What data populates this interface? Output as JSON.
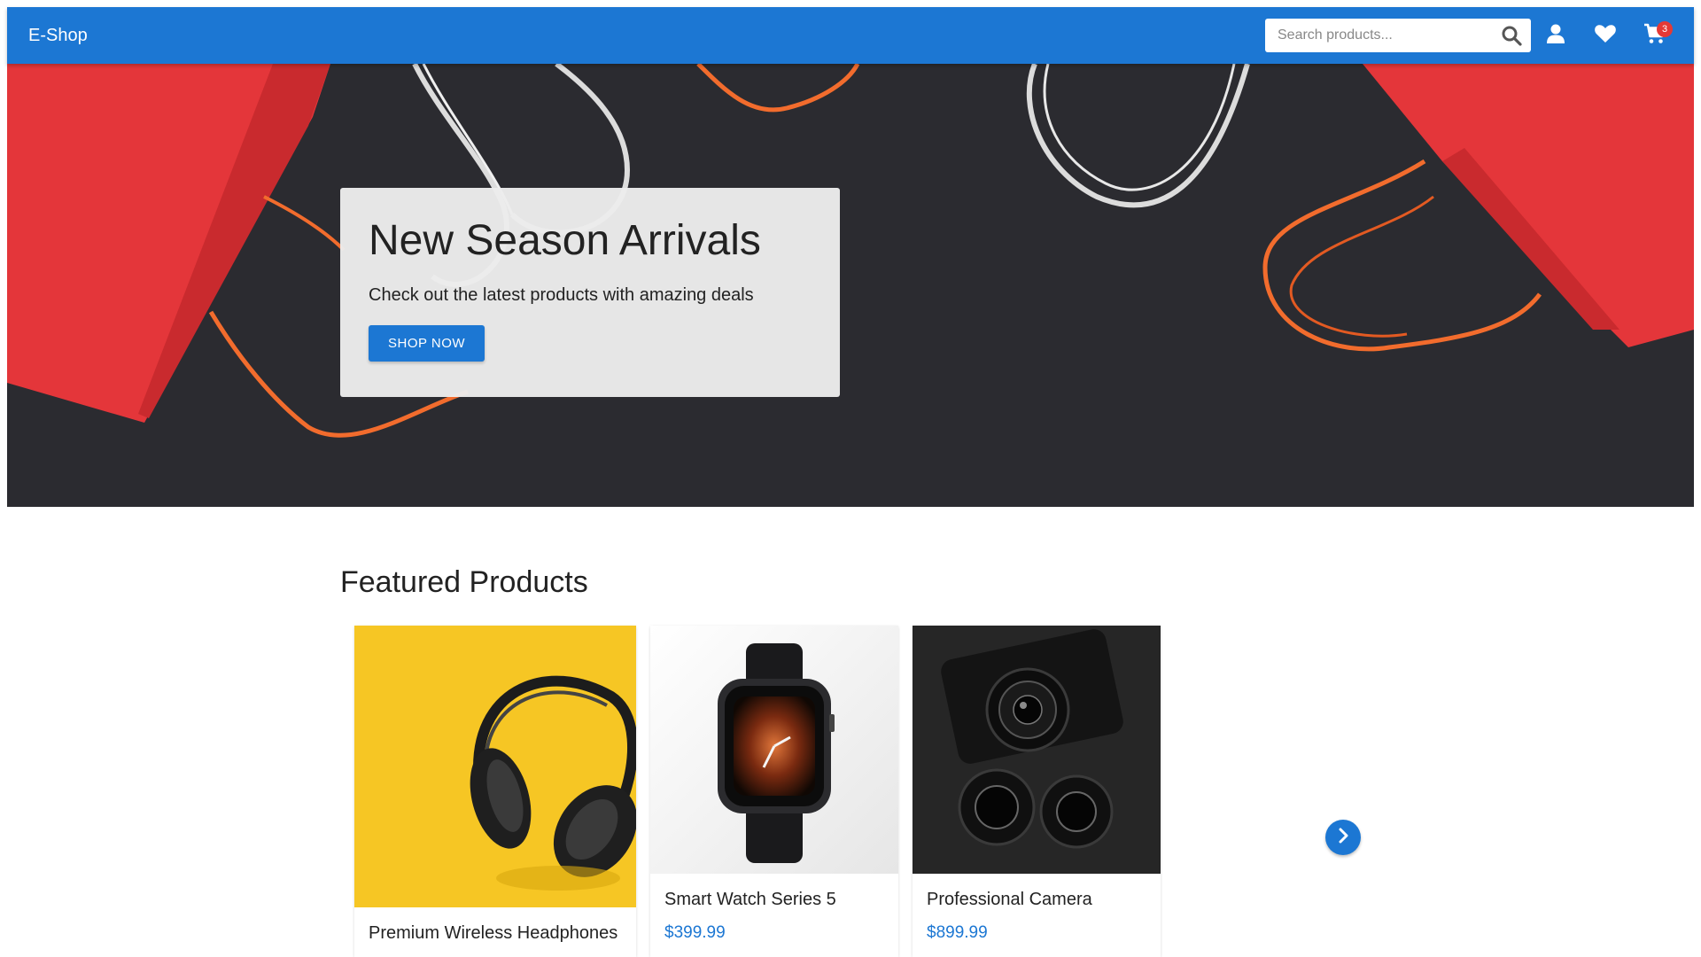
{
  "app": {
    "brand": "E-Shop"
  },
  "header": {
    "search_placeholder": "Search products...",
    "cart_count": "3"
  },
  "hero": {
    "title": "New Season Arrivals",
    "subtitle": "Check out the latest products with amazing deals",
    "cta_label": "SHOP NOW"
  },
  "featured": {
    "title": "Featured Products",
    "products": [
      {
        "name": "Premium Wireless Headphones",
        "price": ""
      },
      {
        "name": "Smart Watch Series 5",
        "price": "$399.99"
      },
      {
        "name": "Professional Camera",
        "price": "$899.99"
      }
    ]
  },
  "colors": {
    "primary": "#1c77d3",
    "badge": "#e53935",
    "hero_bg": "#2b2b30"
  },
  "icons": [
    "search-icon",
    "user-icon",
    "heart-icon",
    "cart-icon",
    "chevron-right-icon"
  ]
}
